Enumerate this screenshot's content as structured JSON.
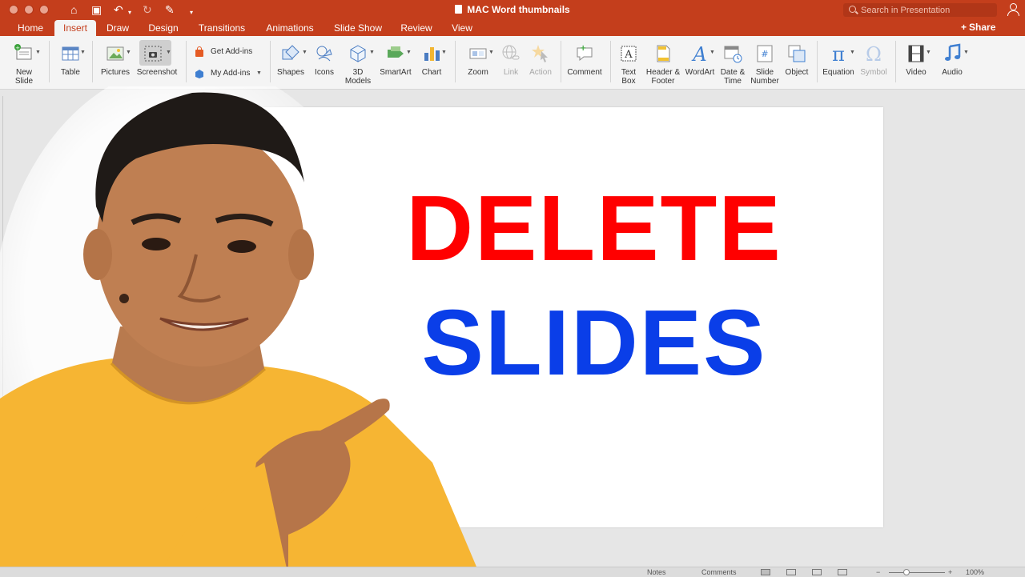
{
  "window": {
    "title": "MAC Word thumbnails",
    "search_placeholder": "Search in Presentation"
  },
  "tabs": [
    "Home",
    "Insert",
    "Draw",
    "Design",
    "Transitions",
    "Animations",
    "Slide Show",
    "Review",
    "View"
  ],
  "active_tab": "Insert",
  "share_label": "Share",
  "ribbon": {
    "new_slide": [
      "New",
      "Slide"
    ],
    "table": "Table",
    "pictures": "Pictures",
    "screenshot": "Screenshot",
    "get_addins": "Get Add-ins",
    "my_addins": "My Add-ins",
    "shapes": "Shapes",
    "icons": "Icons",
    "models_3d": [
      "3D",
      "Models"
    ],
    "smartart": "SmartArt",
    "chart": "Chart",
    "zoom": "Zoom",
    "link": "Link",
    "action": "Action",
    "comment": "Comment",
    "text_box": [
      "Text",
      "Box"
    ],
    "header_footer": [
      "Header &",
      "Footer"
    ],
    "wordart": "WordArt",
    "date_time": [
      "Date &",
      "Time"
    ],
    "slide_number": [
      "Slide",
      "Number"
    ],
    "object": "Object",
    "equation": "Equation",
    "symbol": "Symbol",
    "video": "Video",
    "audio": "Audio"
  },
  "slide": {
    "line1": "DELETE",
    "line2": "SLIDES",
    "line1_color": "#ff0000",
    "line2_color": "#0a3ee8"
  },
  "statusbar": {
    "notes": "Notes",
    "comments": "Comments",
    "zoom": "100%"
  },
  "colors": {
    "accent": "#c43e1c",
    "ribbon_bg": "#f4f4f4"
  }
}
